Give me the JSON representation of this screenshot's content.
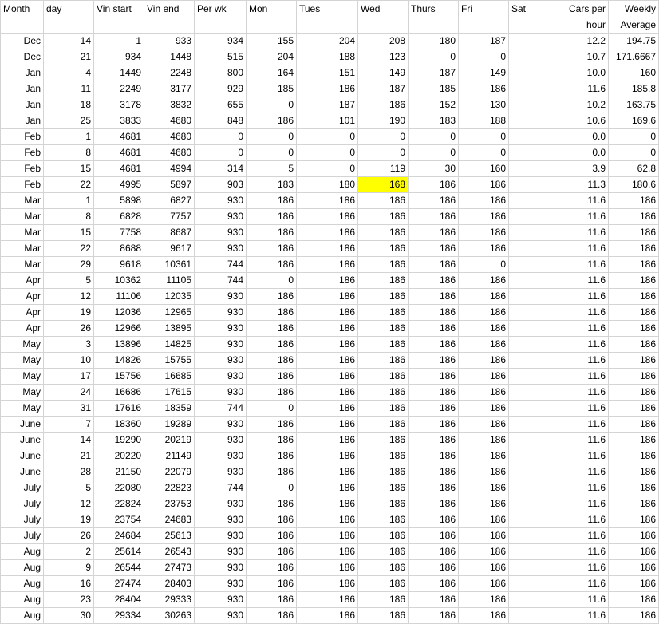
{
  "headers": [
    "Month",
    "day",
    "Vin start",
    "Vin end",
    "Per wk",
    "Mon",
    "Tues",
    "Wed",
    "Thurs",
    "Fri",
    "Sat",
    "Cars per hour",
    "Weekly Average"
  ],
  "highlight_color": "#ffff00",
  "rows": [
    [
      "Dec",
      "14",
      "1",
      "933",
      "934",
      "155",
      "204",
      "208",
      "180",
      "187",
      "",
      "12.2",
      "194.75"
    ],
    [
      "Dec",
      "21",
      "934",
      "1448",
      "515",
      "204",
      "188",
      "123",
      "0",
      "0",
      "",
      "10.7",
      "171.6667"
    ],
    [
      "Jan",
      "4",
      "1449",
      "2248",
      "800",
      "164",
      "151",
      "149",
      "187",
      "149",
      "",
      "10.0",
      "160"
    ],
    [
      "Jan",
      "11",
      "2249",
      "3177",
      "929",
      "185",
      "186",
      "187",
      "185",
      "186",
      "",
      "11.6",
      "185.8"
    ],
    [
      "Jan",
      "18",
      "3178",
      "3832",
      "655",
      "0",
      "187",
      "186",
      "152",
      "130",
      "",
      "10.2",
      "163.75"
    ],
    [
      "Jan",
      "25",
      "3833",
      "4680",
      "848",
      "186",
      "101",
      "190",
      "183",
      "188",
      "",
      "10.6",
      "169.6"
    ],
    [
      "Feb",
      "1",
      "4681",
      "4680",
      "0",
      "0",
      "0",
      "0",
      "0",
      "0",
      "",
      "0.0",
      "0"
    ],
    [
      "Feb",
      "8",
      "4681",
      "4680",
      "0",
      "0",
      "0",
      "0",
      "0",
      "0",
      "",
      "0.0",
      "0"
    ],
    [
      "Feb",
      "15",
      "4681",
      "4994",
      "314",
      "5",
      "0",
      "119",
      "30",
      "160",
      "",
      "3.9",
      "62.8"
    ],
    [
      "Feb",
      "22",
      "4995",
      "5897",
      "903",
      "183",
      "180",
      "168",
      "186",
      "186",
      "",
      "11.3",
      "180.6"
    ],
    [
      "Mar",
      "1",
      "5898",
      "6827",
      "930",
      "186",
      "186",
      "186",
      "186",
      "186",
      "",
      "11.6",
      "186"
    ],
    [
      "Mar",
      "8",
      "6828",
      "7757",
      "930",
      "186",
      "186",
      "186",
      "186",
      "186",
      "",
      "11.6",
      "186"
    ],
    [
      "Mar",
      "15",
      "7758",
      "8687",
      "930",
      "186",
      "186",
      "186",
      "186",
      "186",
      "",
      "11.6",
      "186"
    ],
    [
      "Mar",
      "22",
      "8688",
      "9617",
      "930",
      "186",
      "186",
      "186",
      "186",
      "186",
      "",
      "11.6",
      "186"
    ],
    [
      "Mar",
      "29",
      "9618",
      "10361",
      "744",
      "186",
      "186",
      "186",
      "186",
      "0",
      "",
      "11.6",
      "186"
    ],
    [
      "Apr",
      "5",
      "10362",
      "11105",
      "744",
      "0",
      "186",
      "186",
      "186",
      "186",
      "",
      "11.6",
      "186"
    ],
    [
      "Apr",
      "12",
      "11106",
      "12035",
      "930",
      "186",
      "186",
      "186",
      "186",
      "186",
      "",
      "11.6",
      "186"
    ],
    [
      "Apr",
      "19",
      "12036",
      "12965",
      "930",
      "186",
      "186",
      "186",
      "186",
      "186",
      "",
      "11.6",
      "186"
    ],
    [
      "Apr",
      "26",
      "12966",
      "13895",
      "930",
      "186",
      "186",
      "186",
      "186",
      "186",
      "",
      "11.6",
      "186"
    ],
    [
      "May",
      "3",
      "13896",
      "14825",
      "930",
      "186",
      "186",
      "186",
      "186",
      "186",
      "",
      "11.6",
      "186"
    ],
    [
      "May",
      "10",
      "14826",
      "15755",
      "930",
      "186",
      "186",
      "186",
      "186",
      "186",
      "",
      "11.6",
      "186"
    ],
    [
      "May",
      "17",
      "15756",
      "16685",
      "930",
      "186",
      "186",
      "186",
      "186",
      "186",
      "",
      "11.6",
      "186"
    ],
    [
      "May",
      "24",
      "16686",
      "17615",
      "930",
      "186",
      "186",
      "186",
      "186",
      "186",
      "",
      "11.6",
      "186"
    ],
    [
      "May",
      "31",
      "17616",
      "18359",
      "744",
      "0",
      "186",
      "186",
      "186",
      "186",
      "",
      "11.6",
      "186"
    ],
    [
      "June",
      "7",
      "18360",
      "19289",
      "930",
      "186",
      "186",
      "186",
      "186",
      "186",
      "",
      "11.6",
      "186"
    ],
    [
      "June",
      "14",
      "19290",
      "20219",
      "930",
      "186",
      "186",
      "186",
      "186",
      "186",
      "",
      "11.6",
      "186"
    ],
    [
      "June",
      "21",
      "20220",
      "21149",
      "930",
      "186",
      "186",
      "186",
      "186",
      "186",
      "",
      "11.6",
      "186"
    ],
    [
      "June",
      "28",
      "21150",
      "22079",
      "930",
      "186",
      "186",
      "186",
      "186",
      "186",
      "",
      "11.6",
      "186"
    ],
    [
      "July",
      "5",
      "22080",
      "22823",
      "744",
      "0",
      "186",
      "186",
      "186",
      "186",
      "",
      "11.6",
      "186"
    ],
    [
      "July",
      "12",
      "22824",
      "23753",
      "930",
      "186",
      "186",
      "186",
      "186",
      "186",
      "",
      "11.6",
      "186"
    ],
    [
      "July",
      "19",
      "23754",
      "24683",
      "930",
      "186",
      "186",
      "186",
      "186",
      "186",
      "",
      "11.6",
      "186"
    ],
    [
      "July",
      "26",
      "24684",
      "25613",
      "930",
      "186",
      "186",
      "186",
      "186",
      "186",
      "",
      "11.6",
      "186"
    ],
    [
      "Aug",
      "2",
      "25614",
      "26543",
      "930",
      "186",
      "186",
      "186",
      "186",
      "186",
      "",
      "11.6",
      "186"
    ],
    [
      "Aug",
      "9",
      "26544",
      "27473",
      "930",
      "186",
      "186",
      "186",
      "186",
      "186",
      "",
      "11.6",
      "186"
    ],
    [
      "Aug",
      "16",
      "27474",
      "28403",
      "930",
      "186",
      "186",
      "186",
      "186",
      "186",
      "",
      "11.6",
      "186"
    ],
    [
      "Aug",
      "23",
      "28404",
      "29333",
      "930",
      "186",
      "186",
      "186",
      "186",
      "186",
      "",
      "11.6",
      "186"
    ],
    [
      "Aug",
      "30",
      "29334",
      "30263",
      "930",
      "186",
      "186",
      "186",
      "186",
      "186",
      "",
      "11.6",
      "186"
    ]
  ]
}
